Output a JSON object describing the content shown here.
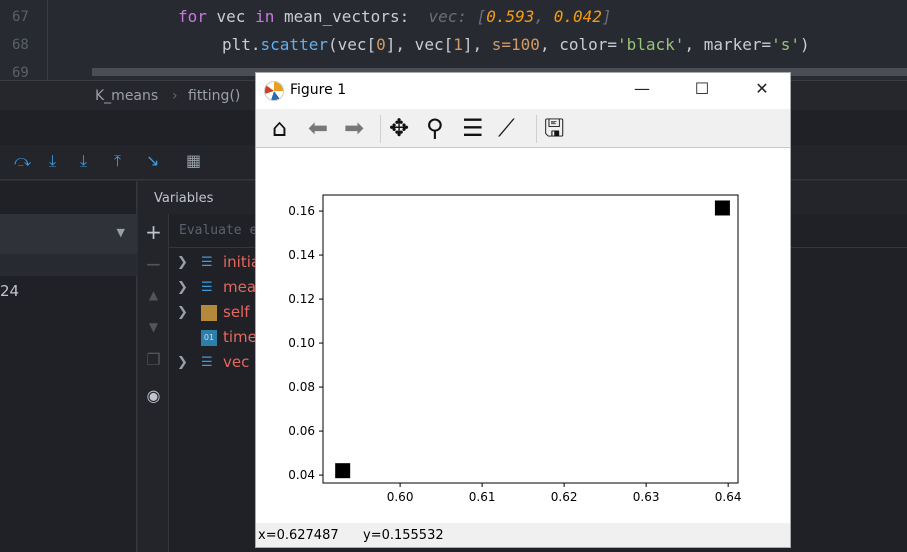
{
  "editor": {
    "lines": [
      {
        "n": "67"
      },
      {
        "n": "68"
      },
      {
        "n": "69"
      }
    ],
    "line67": {
      "kw1": "for",
      "var": " vec ",
      "kw2": "in",
      "rest": " mean_vectors:",
      "hint_label": "vec: [",
      "hint_v1": "0.593",
      "hint_sep": ", ",
      "hint_v2": "0.042",
      "hint_end": "]"
    },
    "line68": {
      "obj": "plt.",
      "fn": "scatter",
      "a1": "(vec[",
      "n0": "0",
      "a2": "], vec[",
      "n1": "1",
      "a3": "], ",
      "s": "s=",
      "sv": "100",
      "c": ", color=",
      "cv": "'black'",
      "m": ", marker=",
      "mv": "'s'",
      "end": ")"
    }
  },
  "breadcrumb": {
    "items": [
      "K_means",
      "fitting()"
    ],
    "sep": "›"
  },
  "left_panel": {
    "value": "24"
  },
  "variables": {
    "header": "Variables",
    "eval_placeholder": "Evaluate expression",
    "items": [
      {
        "name": "initia",
        "type": "list"
      },
      {
        "name": "mea",
        "type": "list"
      },
      {
        "name": "self",
        "type": "object"
      },
      {
        "name": "time",
        "type": "int"
      },
      {
        "name": "vec",
        "type": "list"
      }
    ]
  },
  "figure": {
    "title": "Figure 1",
    "status": {
      "x": "x=0.627487",
      "y": "y=0.155532"
    }
  },
  "chart_data": {
    "type": "scatter",
    "title": "",
    "xlabel": "",
    "ylabel": "",
    "xlim": [
      0.5906,
      0.6412
    ],
    "ylim": [
      0.0364,
      0.1673
    ],
    "xticks": [
      "0.60",
      "0.61",
      "0.62",
      "0.63",
      "0.64"
    ],
    "yticks": [
      "0.04",
      "0.06",
      "0.08",
      "0.10",
      "0.12",
      "0.14",
      "0.16"
    ],
    "points": [
      {
        "x": 0.593,
        "y": 0.042
      },
      {
        "x": 0.6393,
        "y": 0.1614
      }
    ],
    "marker": "square",
    "color": "#000000",
    "grid": false
  }
}
